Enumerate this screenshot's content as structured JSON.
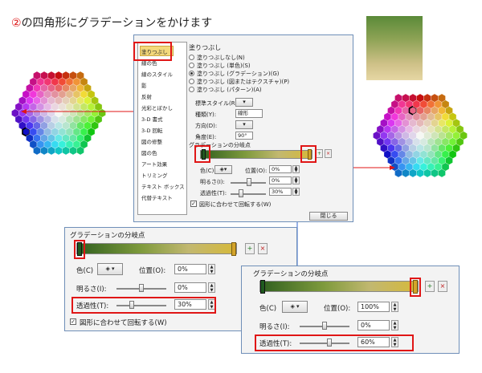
{
  "header": {
    "step_number": "②",
    "instruction": "の四角形にグラデーションをかけます"
  },
  "colors": {
    "accent_red": "#e01616",
    "stop_dark": "#1f5a1f",
    "stop_gold": "#d4a42a",
    "selected_category": "#f4d97b"
  },
  "dialog": {
    "categories": [
      "塗りつぶし",
      "線の色",
      "線のスタイル",
      "影",
      "反射",
      "光彩とぼかし",
      "3-D 書式",
      "3-D 回転",
      "図の修整",
      "図の色",
      "アート効果",
      "トリミング",
      "テキスト ボックス",
      "代替テキスト"
    ],
    "selected_category": "塗りつぶし",
    "section_title": "塗りつぶし",
    "fill_options": [
      {
        "label": "塗りつぶしなし(N)",
        "selected": false
      },
      {
        "label": "塗りつぶし (単色)(S)",
        "selected": false
      },
      {
        "label": "塗りつぶし (グラデーション)(G)",
        "selected": true
      },
      {
        "label": "塗りつぶし (図またはテクスチャ)(P)",
        "selected": false
      },
      {
        "label": "塗りつぶし (パターン)(A)",
        "selected": false
      }
    ],
    "preset_label": "標準スタイル(R):",
    "type_label": "種類(Y):",
    "type_value": "線形",
    "direction_label": "方向(D):",
    "angle_label": "角度(E):",
    "angle_value": "90°",
    "stops_label": "グラデーションの分岐点",
    "color_label": "色(C)",
    "position_label": "位置(O):",
    "position_value": "0%",
    "brightness_label": "明るさ(I):",
    "brightness_value": "0%",
    "transparency_label": "透過性(T):",
    "transparency_value": "30%",
    "rotate_label": "図形に合わせて回転する(W)",
    "rotate_checked": true,
    "close_button": "閉じる"
  },
  "zoom_left": {
    "stops_label": "グラデーションの分岐点",
    "color_label": "色(C)",
    "position_label": "位置(O):",
    "position_value": "0%",
    "brightness_label": "明るさ(I):",
    "brightness_value": "0%",
    "transparency_label": "透過性(T):",
    "transparency_value": "30%",
    "transparency_level": 0.3,
    "rotate_label": "図形に合わせて回転する(W)",
    "rotate_checked": true
  },
  "zoom_right": {
    "stops_label": "グラデーションの分岐点",
    "color_label": "色(C)",
    "position_label": "位置(O):",
    "position_value": "100%",
    "brightness_label": "明るさ(I):",
    "brightness_value": "0%",
    "transparency_label": "透過性(T):",
    "transparency_value": "60%",
    "transparency_level": 0.6
  }
}
